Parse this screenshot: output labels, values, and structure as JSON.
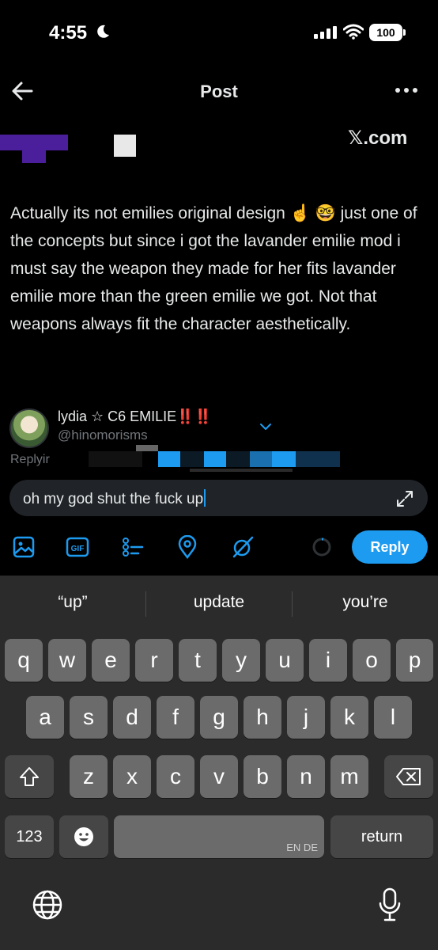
{
  "status_bar": {
    "time": "4:55",
    "battery": "100"
  },
  "nav": {
    "title": "Post"
  },
  "embed": {
    "domain": "𝕏.com"
  },
  "post": {
    "text": "Actually its not emilies original design ☝️ 🤓 just one of the concepts but since i got the lavander emilie mod i must say the weapon they made for her fits lavander emilie more than the green emilie we got. Not that weapons always fit the character aesthetically."
  },
  "reply": {
    "user_name": "lydia ☆ C6 EMILIE",
    "user_badges": "‼️‼️",
    "handle": "@hinomorisms",
    "replying_to": "Replyir",
    "draft": "oh my god shut the fuck up",
    "button_label": "Reply"
  },
  "keyboard": {
    "suggestions": [
      "“up”",
      "update",
      "you’re"
    ],
    "row1": [
      "q",
      "w",
      "e",
      "r",
      "t",
      "y",
      "u",
      "i",
      "o",
      "p"
    ],
    "row2": [
      "a",
      "s",
      "d",
      "f",
      "g",
      "h",
      "j",
      "k",
      "l"
    ],
    "row3": [
      "z",
      "x",
      "c",
      "v",
      "b",
      "n",
      "m"
    ],
    "numbers_key": "123",
    "space_label": "EN DE",
    "return_key": "return"
  },
  "colors": {
    "accent": "#1d9bf0",
    "background": "#000000",
    "keyboard": "#2b2b2b"
  }
}
